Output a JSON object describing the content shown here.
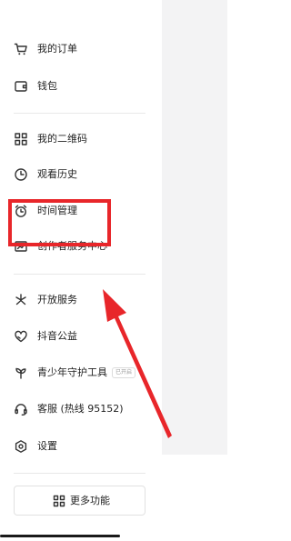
{
  "menu": {
    "items": [
      {
        "key": "orders",
        "label": "我的订单",
        "icon": "cart-icon"
      },
      {
        "key": "wallet",
        "label": "钱包",
        "icon": "wallet-icon"
      },
      {
        "key": "qrcode",
        "label": "我的二维码",
        "icon": "qrcode-icon"
      },
      {
        "key": "history",
        "label": "观看历史",
        "icon": "clock-icon"
      },
      {
        "key": "time",
        "label": "时间管理",
        "icon": "alarm-icon"
      },
      {
        "key": "creator",
        "label": "创作者服务中心",
        "icon": "chart-icon"
      },
      {
        "key": "open",
        "label": "开放服务",
        "icon": "asterisk-icon"
      },
      {
        "key": "charity",
        "label": "抖音公益",
        "icon": "heart-icon"
      },
      {
        "key": "youth",
        "label": "青少年守护工具",
        "icon": "sprout-icon",
        "badge": "已开启"
      },
      {
        "key": "service",
        "label": "客服 (热线 95152)",
        "icon": "headset-icon"
      },
      {
        "key": "settings",
        "label": "设置",
        "icon": "gear-icon"
      }
    ]
  },
  "more_button": {
    "label": "更多功能",
    "icon": "grid-icon"
  },
  "annotation": {
    "color": "#e8262a"
  }
}
